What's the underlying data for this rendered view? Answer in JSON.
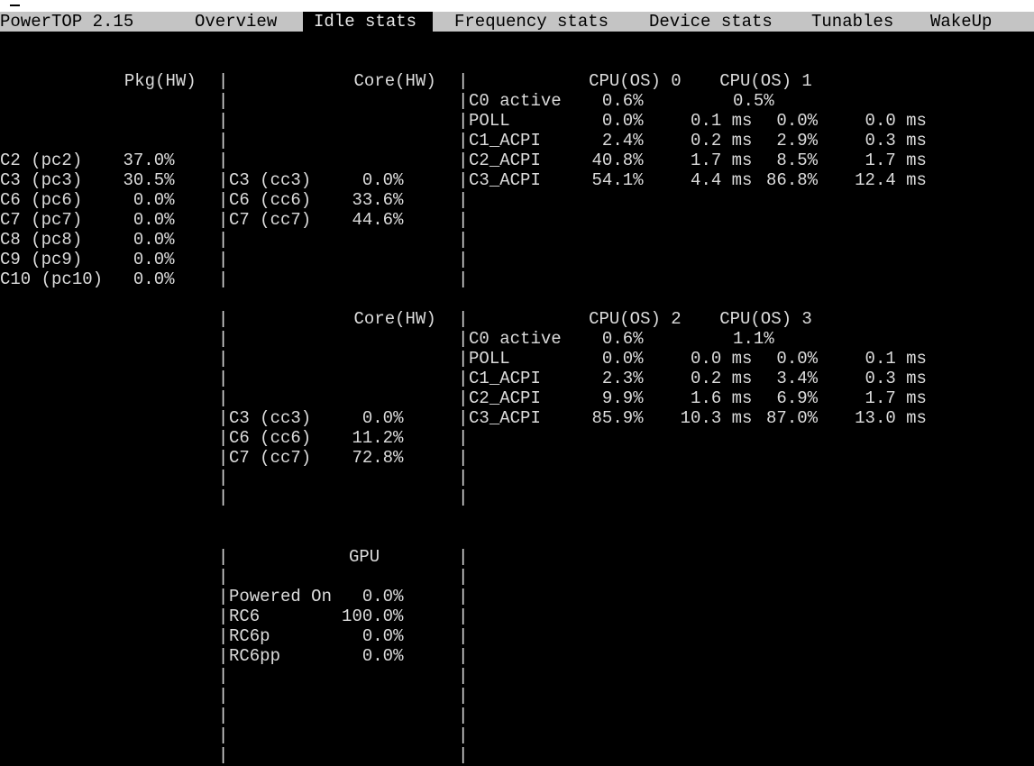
{
  "app_title": "PowerTOP 2.15",
  "tabs": [
    "Overview",
    "Idle stats",
    "Frequency stats",
    "Device stats",
    "Tunables",
    "WakeUp"
  ],
  "active_tab": "Idle stats",
  "package": {
    "header": "Pkg(HW)",
    "rows": [
      {
        "name": "C2 (pc2)",
        "value": "37.0%"
      },
      {
        "name": "C3 (pc3)",
        "value": "30.5%"
      },
      {
        "name": "C6 (pc6)",
        "value": "0.0%"
      },
      {
        "name": "C7 (pc7)",
        "value": "0.0%"
      },
      {
        "name": "C8 (pc8)",
        "value": "0.0%"
      },
      {
        "name": "C9 (pc9)",
        "value": "0.0%"
      },
      {
        "name": "C10 (pc10)",
        "value": "0.0%"
      }
    ]
  },
  "cores": [
    {
      "header": "Core(HW)",
      "rows": [
        {
          "name": "C3 (cc3)",
          "value": "0.0%"
        },
        {
          "name": "C6 (cc6)",
          "value": "33.6%"
        },
        {
          "name": "C7 (cc7)",
          "value": "44.6%"
        }
      ]
    },
    {
      "header": "Core(HW)",
      "rows": [
        {
          "name": "C3 (cc3)",
          "value": "0.0%"
        },
        {
          "name": "C6 (cc6)",
          "value": "11.2%"
        },
        {
          "name": "C7 (cc7)",
          "value": "72.8%"
        }
      ]
    }
  ],
  "cpu_pairs": [
    {
      "cpu_a": "CPU(OS) 0",
      "cpu_b": "CPU(OS) 1",
      "c0": {
        "label": "C0 active",
        "a": "0.6%",
        "b": "0.5%"
      },
      "rows": [
        {
          "name": "POLL",
          "a_pct": "0.0%",
          "a_time": "0.1 ms",
          "b_pct": "0.0%",
          "b_time": "0.0 ms"
        },
        {
          "name": "C1_ACPI",
          "a_pct": "2.4%",
          "a_time": "0.2 ms",
          "b_pct": "2.9%",
          "b_time": "0.3 ms"
        },
        {
          "name": "C2_ACPI",
          "a_pct": "40.8%",
          "a_time": "1.7 ms",
          "b_pct": "8.5%",
          "b_time": "1.7 ms"
        },
        {
          "name": "C3_ACPI",
          "a_pct": "54.1%",
          "a_time": "4.4 ms",
          "b_pct": "86.8%",
          "b_time": "12.4 ms"
        }
      ]
    },
    {
      "cpu_a": "CPU(OS) 2",
      "cpu_b": "CPU(OS) 3",
      "c0": {
        "label": "C0 active",
        "a": "0.6%",
        "b": "1.1%"
      },
      "rows": [
        {
          "name": "POLL",
          "a_pct": "0.0%",
          "a_time": "0.0 ms",
          "b_pct": "0.0%",
          "b_time": "0.1 ms"
        },
        {
          "name": "C1_ACPI",
          "a_pct": "2.3%",
          "a_time": "0.2 ms",
          "b_pct": "3.4%",
          "b_time": "0.3 ms"
        },
        {
          "name": "C2_ACPI",
          "a_pct": "9.9%",
          "a_time": "1.6 ms",
          "b_pct": "6.9%",
          "b_time": "1.7 ms"
        },
        {
          "name": "C3_ACPI",
          "a_pct": "85.9%",
          "a_time": "10.3 ms",
          "b_pct": "87.0%",
          "b_time": "13.0 ms"
        }
      ]
    }
  ],
  "gpu": {
    "header": "GPU",
    "rows": [
      {
        "name": "Powered On",
        "value": "0.0%"
      },
      {
        "name": "RC6",
        "value": "100.0%"
      },
      {
        "name": "RC6p",
        "value": "0.0%"
      },
      {
        "name": "RC6pp",
        "value": "0.0%"
      }
    ]
  },
  "separator_char": "|",
  "colors": {
    "menu_bar": "#c4c4c4",
    "background": "#000000",
    "text": "#dcdcdc"
  }
}
